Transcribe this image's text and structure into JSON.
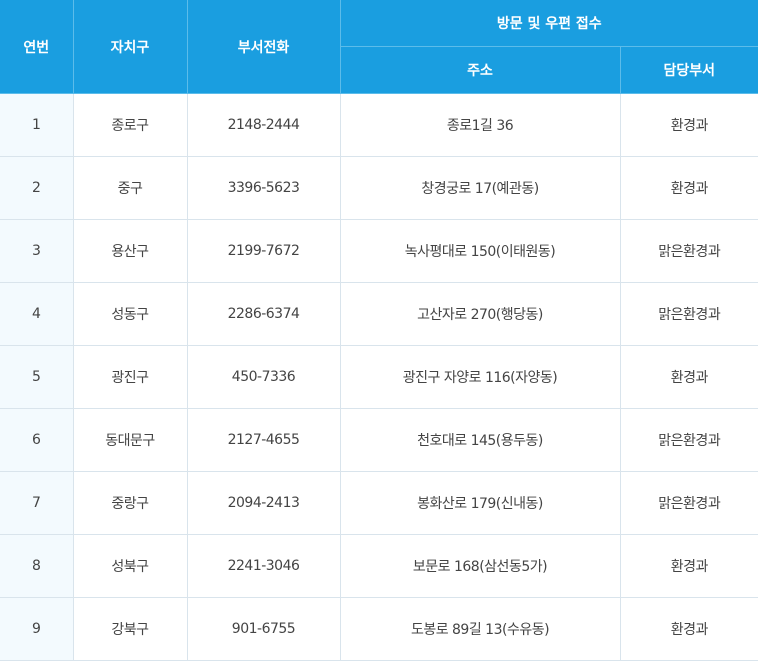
{
  "header": {
    "no": "연번",
    "district": "자치구",
    "phone": "부서전화",
    "group": "방문 및 우편 접수",
    "address": "주소",
    "department": "담당부서"
  },
  "rows": [
    {
      "no": "1",
      "district": "종로구",
      "phone": "2148-2444",
      "address": "종로1길 36",
      "department": "환경과"
    },
    {
      "no": "2",
      "district": "중구",
      "phone": "3396-5623",
      "address": "창경궁로 17(예관동)",
      "department": "환경과"
    },
    {
      "no": "3",
      "district": "용산구",
      "phone": "2199-7672",
      "address": "녹사평대로 150(이태원동)",
      "department": "맑은환경과"
    },
    {
      "no": "4",
      "district": "성동구",
      "phone": "2286-6374",
      "address": "고산자로 270(행당동)",
      "department": "맑은환경과"
    },
    {
      "no": "5",
      "district": "광진구",
      "phone": "450-7336",
      "address": "광진구 자양로 116(자양동)",
      "department": "환경과"
    },
    {
      "no": "6",
      "district": "동대문구",
      "phone": "2127-4655",
      "address": "천호대로 145(용두동)",
      "department": "맑은환경과"
    },
    {
      "no": "7",
      "district": "중랑구",
      "phone": "2094-2413",
      "address": "봉화산로 179(신내동)",
      "department": "맑은환경과"
    },
    {
      "no": "8",
      "district": "성북구",
      "phone": "2241-3046",
      "address": "보문로 168(삼선동5가)",
      "department": "환경과"
    },
    {
      "no": "9",
      "district": "강북구",
      "phone": "901-6755",
      "address": "도봉로 89길 13(수유동)",
      "department": "환경과"
    }
  ]
}
